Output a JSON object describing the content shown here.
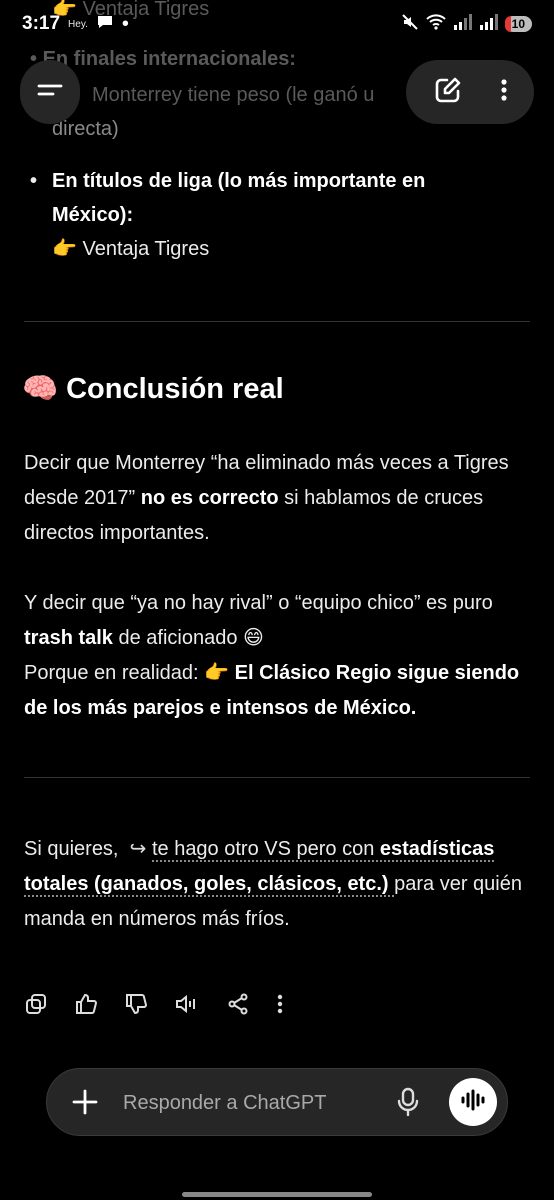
{
  "status_bar": {
    "time": "3:17",
    "notification_text": "Hey.",
    "battery_level": "10"
  },
  "partial_top": {
    "line1": "Ventaja Tigres",
    "bullet_heading": "En finales internacionales:",
    "line2": "Monterrey tiene peso (le ganó u",
    "line3": "directa)"
  },
  "bullet": {
    "heading_line1": "En títulos de liga (lo más importante en",
    "heading_line2": "México):",
    "pointer_emoji": "👉",
    "value": "Ventaja Tigres"
  },
  "conclusion": {
    "emoji": "🧠",
    "title": "Conclusión real",
    "p1_a": "Decir que Monterrey “ha eliminado más veces a Tigres desde 2017”",
    "p1_bold": "no es correcto",
    "p1_b": "si hablamos de cruces directos importantes.",
    "p2_a": "Y decir que “ya no hay rival” o “equipo chico” es puro",
    "p2_bold": "trash talk",
    "p2_b": "de aficionado",
    "p2_emoji": "😄",
    "p3_a": "Porque en realidad:",
    "p3_emoji": "👉",
    "p3_bold": "El Clásico Regio sigue siendo de los más parejos e intensos de México."
  },
  "followup": {
    "prefix": "Si quieres,",
    "arrow": "↪",
    "link_a": "te hago otro VS pero con",
    "link_bold": "estadísticas totales (ganados, goles, clásicos, etc.)",
    "suffix": "para ver quién manda en números más fríos."
  },
  "composer": {
    "placeholder": "Responder a ChatGPT"
  },
  "icons": [
    "menu-icon",
    "edit-icon",
    "more-vert-icon",
    "copy-icon",
    "thumbs-up-icon",
    "thumbs-down-icon",
    "speaker-icon",
    "share-icon",
    "plus-icon",
    "mic-icon",
    "voice-wave-icon"
  ]
}
